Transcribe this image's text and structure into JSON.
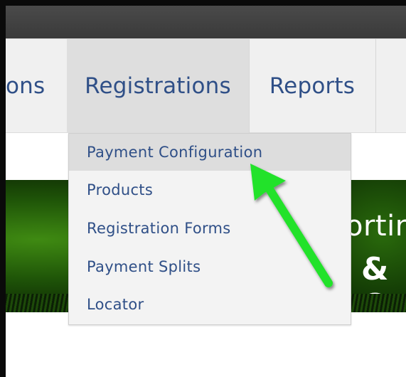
{
  "nav": {
    "items": [
      {
        "label": "ons",
        "state": "partial"
      },
      {
        "label": "Registrations",
        "state": "active"
      },
      {
        "label": "Reports",
        "state": "default"
      }
    ]
  },
  "dropdown": {
    "items": [
      {
        "label": "Payment Configuration",
        "highlighted": true
      },
      {
        "label": "Products"
      },
      {
        "label": "Registration Forms"
      },
      {
        "label": "Payment Splits"
      },
      {
        "label": "Locator"
      }
    ]
  },
  "banner": {
    "line1": "ortin",
    "line2": "& C"
  },
  "annotation": {
    "type": "arrow",
    "color": "#22e22a",
    "points_to": "Payment Configuration"
  },
  "colors": {
    "nav_text": "#2f4f87",
    "nav_bg": "#f0f0f0",
    "nav_active_bg": "#dedede",
    "topbar": "#3f3f3f",
    "dropdown_bg": "#f3f3f3",
    "dropdown_highlight": "#dddddd"
  }
}
